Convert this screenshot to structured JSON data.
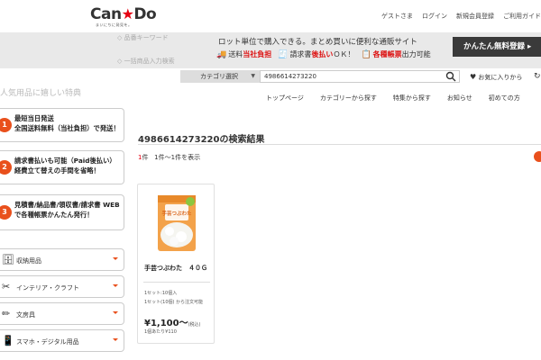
{
  "header": {
    "logo_can": "Can",
    "logo_star": "★",
    "logo_do": "Do",
    "logo_sub": "まいにちに発見を。",
    "links": [
      "ゲストさま",
      "ログイン",
      "新規会員登録",
      "ご利用ガイド"
    ]
  },
  "band": {
    "ghost_1": "◇ 品番キーワード",
    "ghost_2": "◇ 一括商品入力検索",
    "message": "ロット単位で購入できる。まとめ買いに便利な通販サイト",
    "features": [
      {
        "icon": "truck-icon",
        "glyph": "🚚",
        "prefix": "送料",
        "highlight": "当社負担",
        "suffix": ""
      },
      {
        "icon": "invoice-icon",
        "glyph": "🧾",
        "prefix": "請求書",
        "highlight": "後払い",
        "suffix": "ＯＫ！"
      },
      {
        "icon": "form-icon",
        "glyph": "📋",
        "prefix": "",
        "highlight": "各種帳票",
        "suffix": "出力可能"
      }
    ],
    "cta": "かんたん無料登録 ▸"
  },
  "search": {
    "ghost_left": "人気用品に嬉しい特典",
    "category_label": "カテゴリ選択",
    "query": "4986614273220",
    "favorites": "お気に入りから"
  },
  "nav": [
    "トップページ",
    "カテゴリーから探す",
    "特集から探す",
    "お知らせ",
    "初めての方"
  ],
  "promos": [
    {
      "num": "1",
      "text": "最短当日発送\n全国送料無料（当社負担）で発送！"
    },
    {
      "num": "2",
      "text": "請求書払いも可能（Paid後払い）経費立て替えの手間を省略！"
    },
    {
      "num": "3",
      "text": "見積書/納品書/領収書/請求書 WEBで各種帳票かんたん発行！"
    }
  ],
  "categories": [
    {
      "icon": "storage-icon",
      "glyph": "🗄",
      "label": "収納用品"
    },
    {
      "icon": "tools-icon",
      "glyph": "✂",
      "label": "インテリア・クラフト"
    },
    {
      "icon": "pencil-icon",
      "glyph": "✏",
      "label": "文房具"
    },
    {
      "icon": "smartphone-icon",
      "glyph": "📱",
      "label": "スマホ・デジタル用品"
    }
  ],
  "results": {
    "title": "4986614273220の検索結果",
    "count_num": "1",
    "count_unit": "件",
    "range": "1件～1件を表示"
  },
  "product": {
    "name": "手芸つぶわた　４０Ｇ",
    "spec_1": "1セット:10個入",
    "spec_2": "1セット(10個) から注文可能",
    "price": "¥1,100～",
    "tax": "(税込)",
    "unit_price": "1個あたり¥110",
    "package_label": "手芸つぶわた",
    "colors": {
      "bag": "#f3a24a",
      "cotton": "#f5f5f0",
      "tag": "#8cc63f"
    }
  }
}
